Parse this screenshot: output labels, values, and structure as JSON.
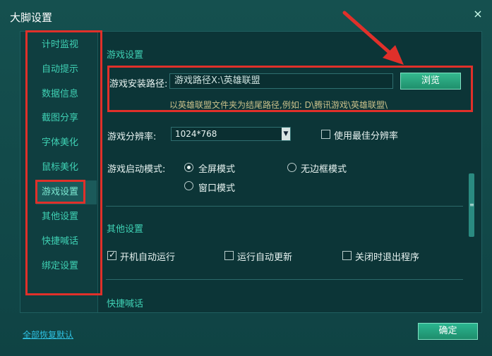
{
  "window": {
    "title": "大脚设置",
    "close_glyph": "×"
  },
  "sidebar": {
    "items": [
      {
        "label": "计时监视"
      },
      {
        "label": "自动提示"
      },
      {
        "label": "数据信息"
      },
      {
        "label": "截图分享"
      },
      {
        "label": "字体美化"
      },
      {
        "label": "鼠标美化"
      },
      {
        "label": "游戏设置",
        "active": true
      },
      {
        "label": "其他设置"
      },
      {
        "label": "快捷喊话"
      },
      {
        "label": "绑定设置"
      }
    ]
  },
  "game_settings": {
    "section_title": "游戏设置",
    "install_path_label": "游戏安装路径:",
    "install_path_value": "游戏路径X:\\英雄联盟",
    "browse_label": "浏览",
    "path_hint": "以英雄联盟文件夹为结尾路径,例如: D\\腾讯游戏\\英雄联盟\\",
    "resolution_label": "游戏分辨率:",
    "resolution_value": "1024*768",
    "best_resolution_label": "使用最佳分辨率",
    "best_resolution_checked": false,
    "launch_mode_label": "游戏启动模式:",
    "launch_modes": [
      {
        "label": "全屏模式",
        "selected": true
      },
      {
        "label": "无边框模式",
        "selected": false
      },
      {
        "label": "窗口模式",
        "selected": false
      }
    ]
  },
  "other_settings": {
    "section_title": "其他设置",
    "options": [
      {
        "label": "开机自动运行",
        "checked": true
      },
      {
        "label": "运行自动更新",
        "checked": false
      },
      {
        "label": "关闭时退出程序",
        "checked": false
      }
    ]
  },
  "quick_chat": {
    "section_title": "快捷喊话"
  },
  "footer": {
    "restore_defaults": "全部恢复默认",
    "ok_label": "确定"
  },
  "colors": {
    "accent_text": "#3fd1b4",
    "button_green": "#2bb690",
    "annotation_red": "#e0302a"
  }
}
